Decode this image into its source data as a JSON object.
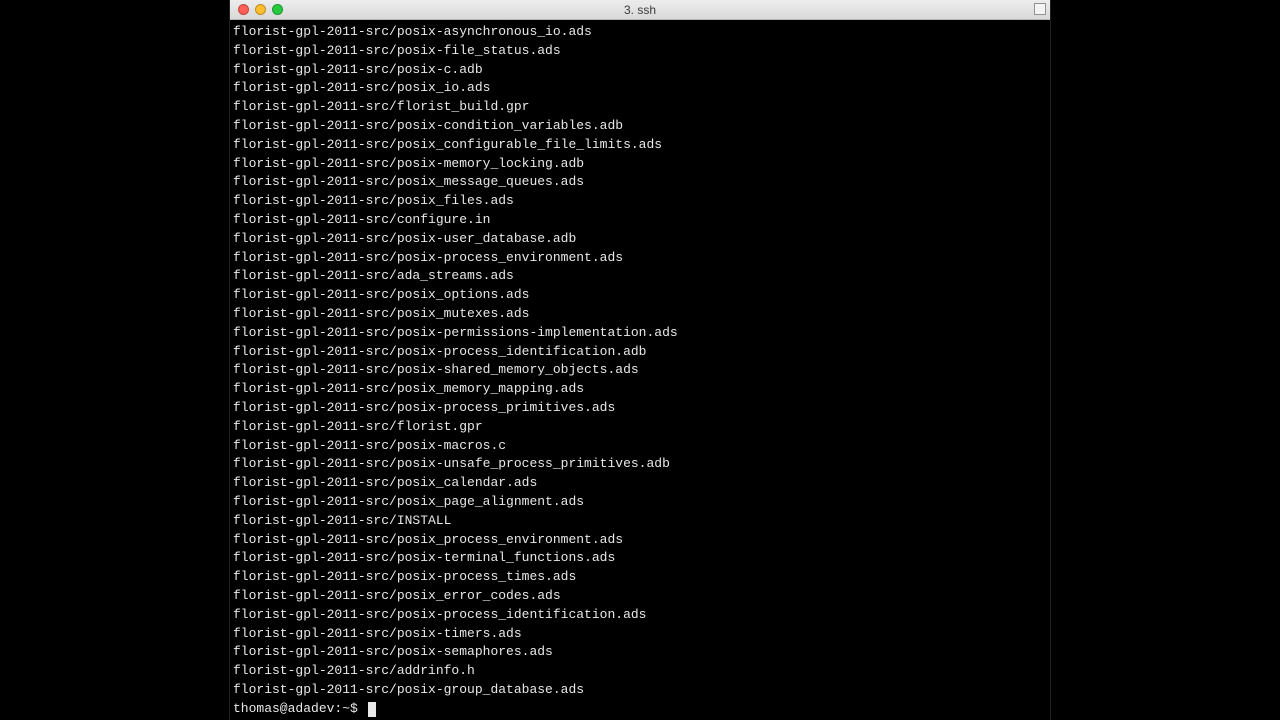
{
  "window": {
    "title": "3. ssh"
  },
  "terminal": {
    "lines": [
      "florist-gpl-2011-src/posix-asynchronous_io.ads",
      "florist-gpl-2011-src/posix-file_status.ads",
      "florist-gpl-2011-src/posix-c.adb",
      "florist-gpl-2011-src/posix_io.ads",
      "florist-gpl-2011-src/florist_build.gpr",
      "florist-gpl-2011-src/posix-condition_variables.adb",
      "florist-gpl-2011-src/posix_configurable_file_limits.ads",
      "florist-gpl-2011-src/posix-memory_locking.adb",
      "florist-gpl-2011-src/posix_message_queues.ads",
      "florist-gpl-2011-src/posix_files.ads",
      "florist-gpl-2011-src/configure.in",
      "florist-gpl-2011-src/posix-user_database.adb",
      "florist-gpl-2011-src/posix-process_environment.ads",
      "florist-gpl-2011-src/ada_streams.ads",
      "florist-gpl-2011-src/posix_options.ads",
      "florist-gpl-2011-src/posix_mutexes.ads",
      "florist-gpl-2011-src/posix-permissions-implementation.ads",
      "florist-gpl-2011-src/posix-process_identification.adb",
      "florist-gpl-2011-src/posix-shared_memory_objects.ads",
      "florist-gpl-2011-src/posix_memory_mapping.ads",
      "florist-gpl-2011-src/posix-process_primitives.ads",
      "florist-gpl-2011-src/florist.gpr",
      "florist-gpl-2011-src/posix-macros.c",
      "florist-gpl-2011-src/posix-unsafe_process_primitives.adb",
      "florist-gpl-2011-src/posix_calendar.ads",
      "florist-gpl-2011-src/posix_page_alignment.ads",
      "florist-gpl-2011-src/INSTALL",
      "florist-gpl-2011-src/posix_process_environment.ads",
      "florist-gpl-2011-src/posix-terminal_functions.ads",
      "florist-gpl-2011-src/posix-process_times.ads",
      "florist-gpl-2011-src/posix_error_codes.ads",
      "florist-gpl-2011-src/posix-process_identification.ads",
      "florist-gpl-2011-src/posix-timers.ads",
      "florist-gpl-2011-src/posix-semaphores.ads",
      "florist-gpl-2011-src/addrinfo.h",
      "florist-gpl-2011-src/posix-group_database.ads"
    ],
    "prompt": "thomas@adadev:~$ "
  }
}
